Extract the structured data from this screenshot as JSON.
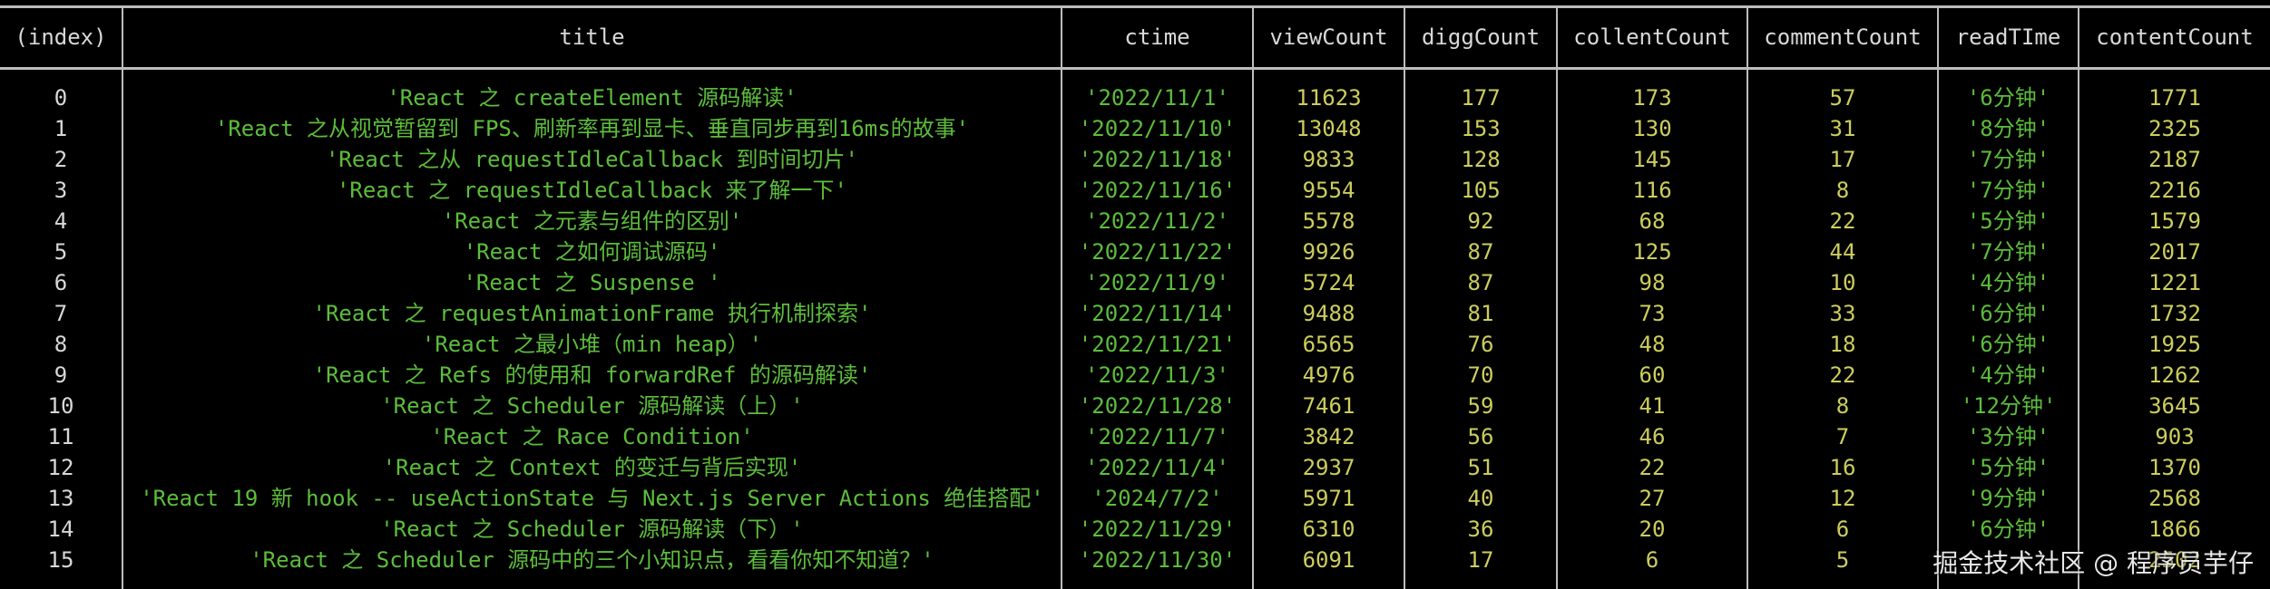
{
  "columns": [
    "(index)",
    "title",
    "ctime",
    "viewCount",
    "diggCount",
    "collentCount",
    "commentCount",
    "readTIme",
    "contentCount"
  ],
  "rows": [
    [
      "0",
      "'React 之 createElement 源码解读'",
      "'2022/11/1'",
      "11623",
      "177",
      "173",
      "57",
      "'6分钟'",
      "1771"
    ],
    [
      "1",
      "'React 之从视觉暂留到 FPS、刷新率再到显卡、垂直同步再到16ms的故事'",
      "'2022/11/10'",
      "13048",
      "153",
      "130",
      "31",
      "'8分钟'",
      "2325"
    ],
    [
      "2",
      "'React 之从 requestIdleCallback 到时间切片'",
      "'2022/11/18'",
      "9833",
      "128",
      "145",
      "17",
      "'7分钟'",
      "2187"
    ],
    [
      "3",
      "'React 之 requestIdleCallback 来了解一下'",
      "'2022/11/16'",
      "9554",
      "105",
      "116",
      "8",
      "'7分钟'",
      "2216"
    ],
    [
      "4",
      "'React 之元素与组件的区别'",
      "'2022/11/2'",
      "5578",
      "92",
      "68",
      "22",
      "'5分钟'",
      "1579"
    ],
    [
      "5",
      "'React 之如何调试源码'",
      "'2022/11/22'",
      "9926",
      "87",
      "125",
      "44",
      "'7分钟'",
      "2017"
    ],
    [
      "6",
      "'React 之 Suspense '",
      "'2022/11/9'",
      "5724",
      "87",
      "98",
      "10",
      "'4分钟'",
      "1221"
    ],
    [
      "7",
      "'React 之 requestAnimationFrame 执行机制探索'",
      "'2022/11/14'",
      "9488",
      "81",
      "73",
      "33",
      "'6分钟'",
      "1732"
    ],
    [
      "8",
      "'React 之最小堆（min heap）'",
      "'2022/11/21'",
      "6565",
      "76",
      "48",
      "18",
      "'6分钟'",
      "1925"
    ],
    [
      "9",
      "'React 之 Refs 的使用和 forwardRef 的源码解读'",
      "'2022/11/3'",
      "4976",
      "70",
      "60",
      "22",
      "'4分钟'",
      "1262"
    ],
    [
      "10",
      "'React 之 Scheduler 源码解读（上）'",
      "'2022/11/28'",
      "7461",
      "59",
      "41",
      "8",
      "'12分钟'",
      "3645"
    ],
    [
      "11",
      "'React 之 Race Condition'",
      "'2022/11/7'",
      "3842",
      "56",
      "46",
      "7",
      "'3分钟'",
      "903"
    ],
    [
      "12",
      "'React 之 Context 的变迁与背后实现'",
      "'2022/11/4'",
      "2937",
      "51",
      "22",
      "16",
      "'5分钟'",
      "1370"
    ],
    [
      "13",
      "'React 19 新 hook -- useActionState 与 Next.js Server Actions 绝佳搭配'",
      "'2024/7/2'",
      "5971",
      "40",
      "27",
      "12",
      "'9分钟'",
      "2568"
    ],
    [
      "14",
      "'React 之 Scheduler 源码解读（下）'",
      "'2022/11/29'",
      "6310",
      "36",
      "20",
      "6",
      "'6分钟'",
      "1866"
    ],
    [
      "15",
      "'React 之 Scheduler 源码中的三个小知识点，看看你知不知道？'",
      "'2022/11/30'",
      "6091",
      "17",
      "6",
      "5",
      "",
      "2502"
    ]
  ],
  "watermark": "掘金技术社区 @ 程序员芋仔",
  "colors": {
    "string": "#5cbd3c",
    "number": "#cdcd5e",
    "header": "#d8d8d8",
    "border": "#bdbdbd"
  }
}
